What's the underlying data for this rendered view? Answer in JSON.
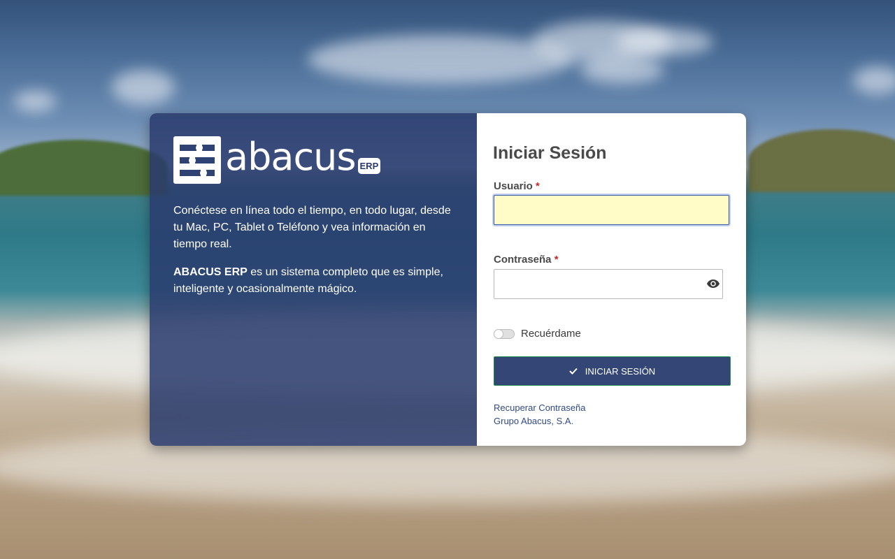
{
  "brand": {
    "logo_word": "abacus",
    "logo_badge": "ERP"
  },
  "intro": {
    "paragraph1": "Conéctese en línea todo el tiempo, en todo lugar, desde tu Mac, PC, Tablet o Teléfono y vea información en tiempo real.",
    "paragraph2_strong": "ABACUS ERP",
    "paragraph2_rest": " es un sistema completo que es simple, inteligente y ocasionalmente mágico."
  },
  "form": {
    "title": "Iniciar Sesión",
    "username_label": "Usuario",
    "username_value": "",
    "password_label": "Contraseña",
    "password_value": "",
    "required_mark": "*",
    "remember_label": "Recuérdame",
    "remember_checked": false,
    "submit_label": "INICIAR SESIÓN",
    "recover_link": "Recuperar Contraseña",
    "company": "Grupo Abacus, S.A."
  },
  "icons": {
    "logo": "abacus-logo-icon",
    "password_toggle": "eye-icon",
    "submit": "check-icon"
  },
  "colors": {
    "panel": "#2a3b6e",
    "button": "#334676",
    "button_border": "#1f8a4c",
    "required": "#c62828",
    "focus_fill": "#fffcc8"
  }
}
